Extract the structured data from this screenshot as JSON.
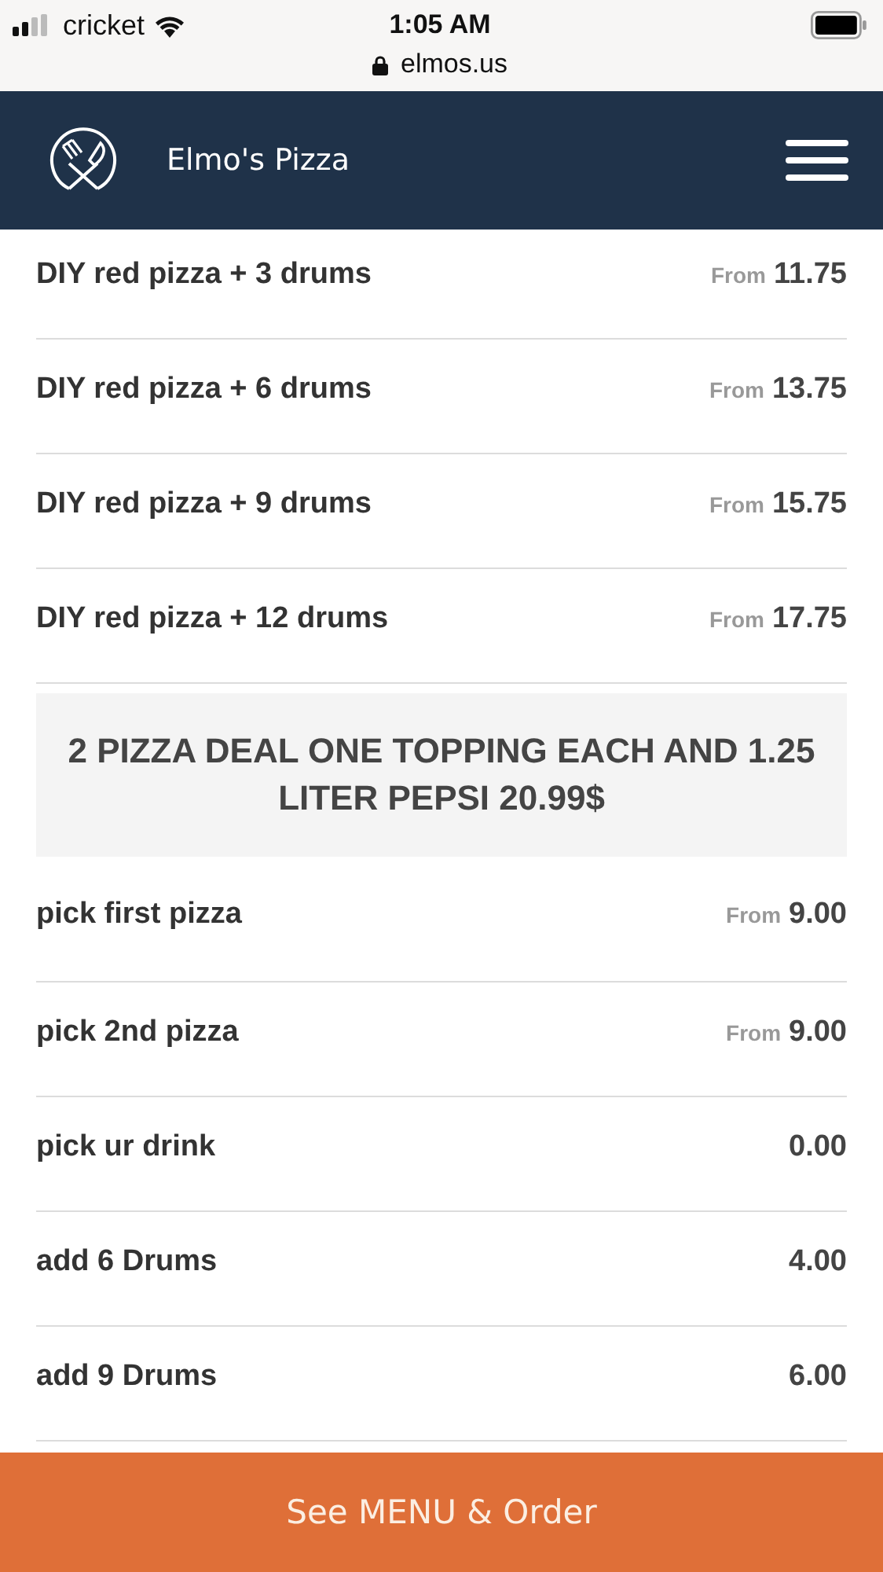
{
  "status_bar": {
    "carrier": "cricket",
    "time": "1:05 AM"
  },
  "address_bar": {
    "url": "elmos.us"
  },
  "header": {
    "title": "Elmo's Pizza"
  },
  "sections": [
    {
      "items": [
        {
          "name": "DIY red pizza + 3 drums",
          "price_prefix": "From",
          "price": "11.75"
        },
        {
          "name": "DIY red pizza + 6 drums",
          "price_prefix": "From",
          "price": "13.75"
        },
        {
          "name": "DIY red pizza + 9 drums",
          "price_prefix": "From",
          "price": "15.75"
        },
        {
          "name": "DIY red pizza + 12 drums",
          "price_prefix": "From",
          "price": "17.75"
        }
      ]
    },
    {
      "heading": "2 PIZZA DEAL ONE TOPPING EACH AND 1.25 LITER PEPSI 20.99$",
      "items": [
        {
          "name": "pick first pizza",
          "price_prefix": "From",
          "price": "9.00"
        },
        {
          "name": "pick 2nd pizza",
          "price_prefix": "From",
          "price": "9.00"
        },
        {
          "name": "pick ur drink",
          "price": "0.00"
        },
        {
          "name": "add 6 Drums",
          "price": "4.00"
        },
        {
          "name": "add 9 Drums",
          "price": "6.00"
        }
      ]
    }
  ],
  "order_button": {
    "label": "See MENU & Order"
  }
}
